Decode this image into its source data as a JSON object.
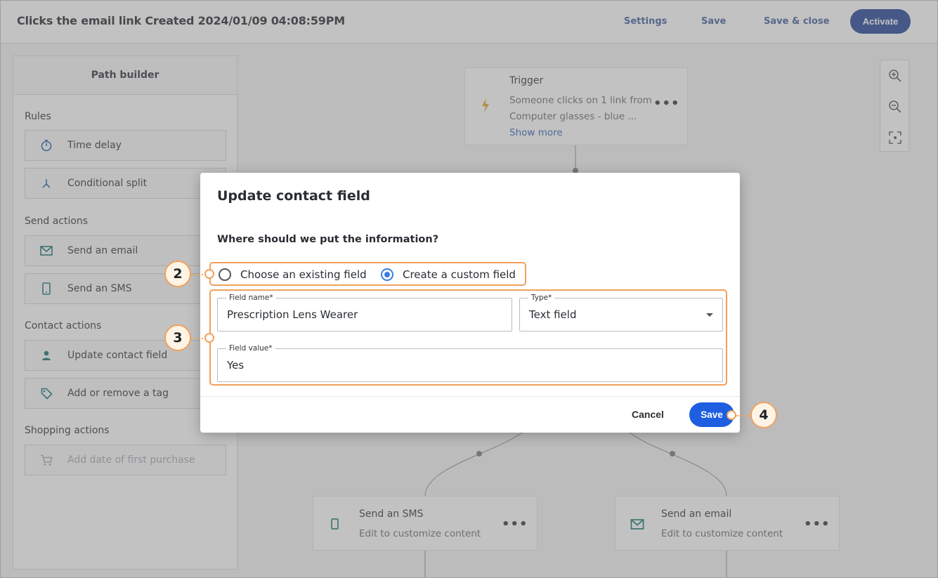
{
  "header": {
    "title": "Clicks the email link Created 2024/01/09 04:08:59PM",
    "settings": "Settings",
    "save": "Save",
    "save_close": "Save & close",
    "activate": "Activate"
  },
  "sidebar": {
    "title": "Path builder",
    "sections": {
      "rules": "Rules",
      "send_actions": "Send actions",
      "contact_actions": "Contact actions",
      "shopping_actions": "Shopping actions"
    },
    "items": {
      "time_delay": "Time delay",
      "conditional_split": "Conditional split",
      "send_email": "Send an email",
      "send_sms": "Send an SMS",
      "update_contact_field": "Update contact field",
      "add_remove_tag": "Add or remove a tag",
      "add_date_first_purchase": "Add date of first purchase"
    }
  },
  "canvas": {
    "trigger": {
      "title": "Trigger",
      "line1": "Someone clicks on 1 link from",
      "line2": "Computer glasses - blue ...",
      "show_more": "Show more",
      "more": "•••"
    },
    "sms_node": {
      "title": "Send an SMS",
      "subtitle": "Edit to customize content",
      "more": "•••"
    },
    "email_node": {
      "title": "Send an email",
      "subtitle": "Edit to customize content",
      "more": "•••"
    }
  },
  "modal": {
    "title": "Update contact field",
    "question": "Where should we put the information?",
    "radio_existing": "Choose an existing field",
    "radio_custom": "Create a custom field",
    "field_name_label": "Field name*",
    "field_name_value": "Prescription Lens Wearer",
    "type_label": "Type*",
    "type_value": "Text field",
    "field_value_label": "Field value*",
    "field_value_value": "Yes",
    "cancel": "Cancel",
    "save": "Save"
  },
  "callouts": {
    "step2": "2",
    "step3": "3",
    "step4": "4"
  },
  "colors": {
    "accent": "#1e5ee0",
    "activate": "#1c3f95",
    "callout": "#f0a15c",
    "icon_teal": "#0f6e6e"
  }
}
